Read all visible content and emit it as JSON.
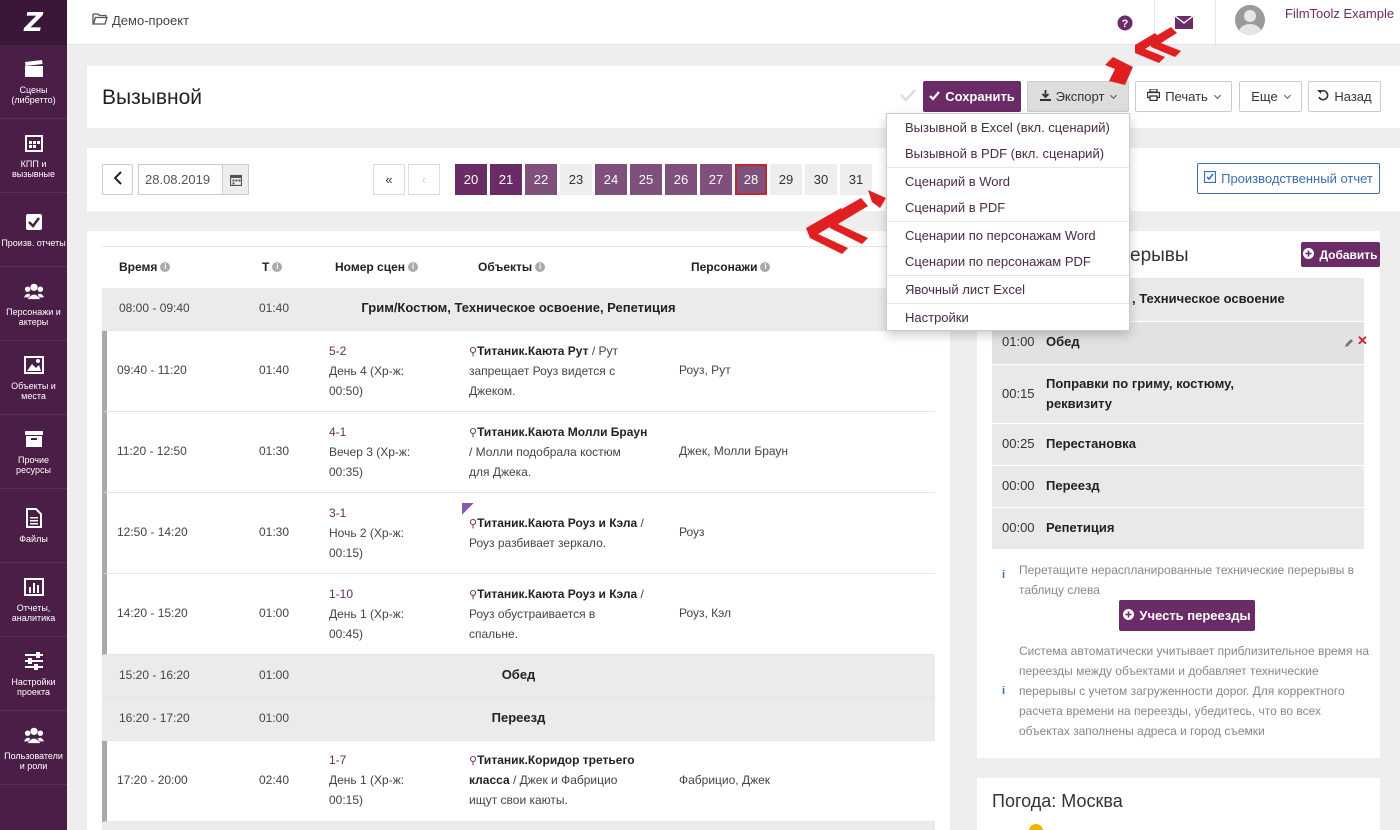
{
  "sidebar": {
    "logo": "Z",
    "items": [
      {
        "label": "Сцены (либретто)",
        "icon": "clapperboard-icon"
      },
      {
        "label": "КПП и вызывные",
        "icon": "calendar-icon"
      },
      {
        "label": "Произв. отчеты",
        "icon": "checkbox-icon"
      },
      {
        "label": "Персонажи и актеры",
        "icon": "users-icon"
      },
      {
        "label": "Объекты и места",
        "icon": "image-icon"
      },
      {
        "label": "Прочие ресурсы",
        "icon": "box-icon"
      },
      {
        "label": "Файлы",
        "icon": "file-icon"
      },
      {
        "label": "Отчеты, аналитика",
        "icon": "bar-chart-icon"
      },
      {
        "label": "Настройки проекта",
        "icon": "sliders-icon"
      },
      {
        "label": "Пользователи и роли",
        "icon": "users-icon"
      }
    ]
  },
  "topbar": {
    "breadcrumb": "Демо-проект",
    "help_icon": "question-circle-icon",
    "mail_icon": "envelope-icon",
    "user_name": "FilmToolz Example"
  },
  "header": {
    "title": "Вызывной",
    "save_label": "Сохранить",
    "export_label": "Экспорт",
    "print_label": "Печать",
    "more_label": "Еще",
    "back_label": "Назад"
  },
  "date_bar": {
    "date": "28.08.2019",
    "first_label": "«",
    "prev_label": "‹",
    "days": [
      "20",
      "21",
      "22",
      "23",
      "24",
      "25",
      "26",
      "27",
      "28",
      "29",
      "30",
      "31"
    ],
    "report_label": "Производственный отчет"
  },
  "export_menu": [
    "Вызывной в Excel (вкл. сценарий)",
    "Вызывной в PDF (вкл. сценарий)",
    "Сценарий в Word",
    "Сценарий в PDF",
    "Сценарии по персонажам Word",
    "Сценарии по персонажам PDF",
    "Явочный лист Excel",
    "Настройки"
  ],
  "schedule": {
    "headers": {
      "time": "Время",
      "t": "Т",
      "scene": "Номер сцен",
      "objects": "Объекты",
      "characters": "Персонажи"
    },
    "row_group1": {
      "time": "08:00 - 09:40",
      "t": "01:40",
      "title": "Грим/Костюм, Техническое освоение, Репетиция"
    },
    "scenes": [
      {
        "time": "09:40 - 11:20",
        "t": "01:40",
        "num": "5-2",
        "desc1": "День 4 (Хр-ж:",
        "desc2": "00:50)",
        "obj_bold": "Титаник.Каюта Рут",
        "obj_rest1": " / Рут",
        "obj_line2": "запрещает Роуз видется с",
        "obj_line3": "Джеком.",
        "chars": "Роуз, Рут"
      },
      {
        "time": "11:20 - 12:50",
        "t": "01:30",
        "num": "4-1",
        "desc1": "Вечер 3 (Хр-ж:",
        "desc2": "00:35)",
        "obj_bold": "Титаник.Каюта Молли Браун",
        "obj_rest1": "",
        "obj_line2": "/ Молли подобрала костюм",
        "obj_line3": "для Джека.",
        "chars": "Джек, Молли Браун"
      },
      {
        "time": "12:50 - 14:20",
        "t": "01:30",
        "num": "3-1",
        "desc1": "Ночь 2 (Хр-ж:",
        "desc2": "00:15)",
        "obj_bold": "Титаник.Каюта Роуз и Кэла",
        "obj_rest1": " /",
        "obj_line2": "Роуз разбивает зеркало.",
        "obj_line3": "",
        "chars": "Роуз"
      },
      {
        "time": "14:20 - 15:20",
        "t": "01:00",
        "num": "1-10",
        "desc1": "День 1 (Хр-ж:",
        "desc2": "00:45)",
        "obj_bold": "Титаник.Каюта Роуз и Кэла",
        "obj_rest1": " /",
        "obj_line2": "Роуз обустраивается в",
        "obj_line3": "спальне.",
        "chars": "Роуз, Кэл"
      }
    ],
    "lunch": {
      "time": "15:20 - 16:20",
      "t": "01:00",
      "title": "Обед"
    },
    "move": {
      "time": "16:20 - 17:20",
      "t": "01:00",
      "title": "Переезд"
    },
    "last": {
      "time": "17:20 - 20:00",
      "t": "02:40",
      "num": "1-7",
      "desc1": "День 1 (Хр-ж:",
      "desc2": "00:15)",
      "obj_bold1": "Титаник.Коридор третьего",
      "obj_bold2": "класса",
      "obj_rest": " / Джек и Фабрицио",
      "obj_line3": "ищут свои каюты.",
      "chars": "Фабрицио, Джек"
    }
  },
  "breaks": {
    "title": "ерывы",
    "add_label": "Добавить",
    "rows": [
      {
        "t": "",
        "name": ", Техническое освоение"
      },
      {
        "t": "01:00",
        "name": "Обед"
      },
      {
        "t": "00:15",
        "name": "Поправки по гриму, костюму, реквизиту"
      },
      {
        "t": "00:25",
        "name": "Перестановка"
      },
      {
        "t": "00:00",
        "name": "Переезд"
      },
      {
        "t": "00:00",
        "name": "Репетиция"
      }
    ],
    "note1": "Перетащите нераспланированные технические перерывы в таблицу слева",
    "moves_label": "Учесть переезды",
    "note2": "Система автоматически учитывает приблизительное время на переезды между объектами и добавляет технические перерывы с учетом загруженности дорог. Для корректного расчета времени на переезды, убедитесь, что во всех объектах заполнены адреса и город съемки"
  },
  "weather": {
    "title": "Погода: Москва"
  },
  "colors": {
    "brand": "#6b2b66",
    "sidebar": "#4a1e47",
    "arrow": "#e02020"
  }
}
